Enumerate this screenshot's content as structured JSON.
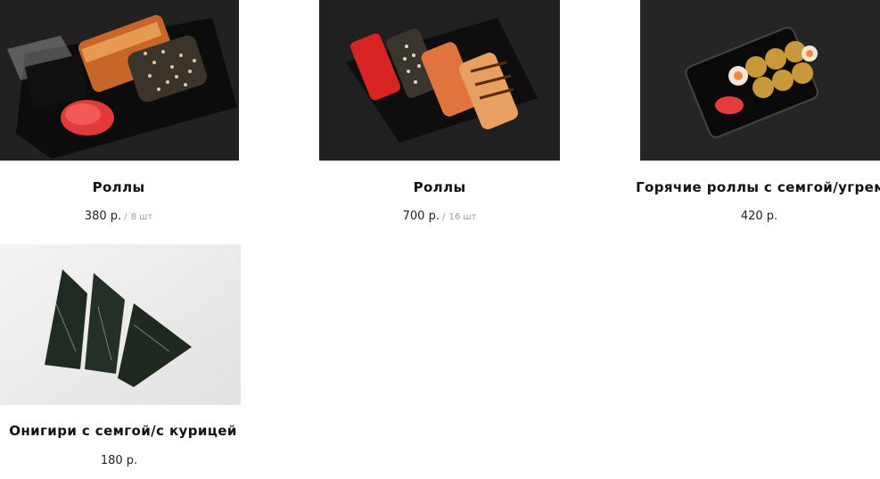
{
  "products": [
    {
      "image": "rolls-set-box-photo",
      "title": "Роллы",
      "price": "380 р.",
      "quantity_sep": "/",
      "quantity": "8 шт"
    },
    {
      "image": "rolls-assorted-box-photo",
      "title": "Роллы",
      "price": "700 р.",
      "quantity_sep": "/",
      "quantity": "16 шт"
    },
    {
      "image": "hot-rolls-box-photo",
      "title": "Горячие роллы с семгой/угрем",
      "price": "420 р.",
      "quantity_sep": "",
      "quantity": ""
    },
    {
      "image": "onigiri-photo",
      "title": "Онигири с семгой/с курицей",
      "price": "180 р.",
      "quantity_sep": "",
      "quantity": ""
    }
  ]
}
